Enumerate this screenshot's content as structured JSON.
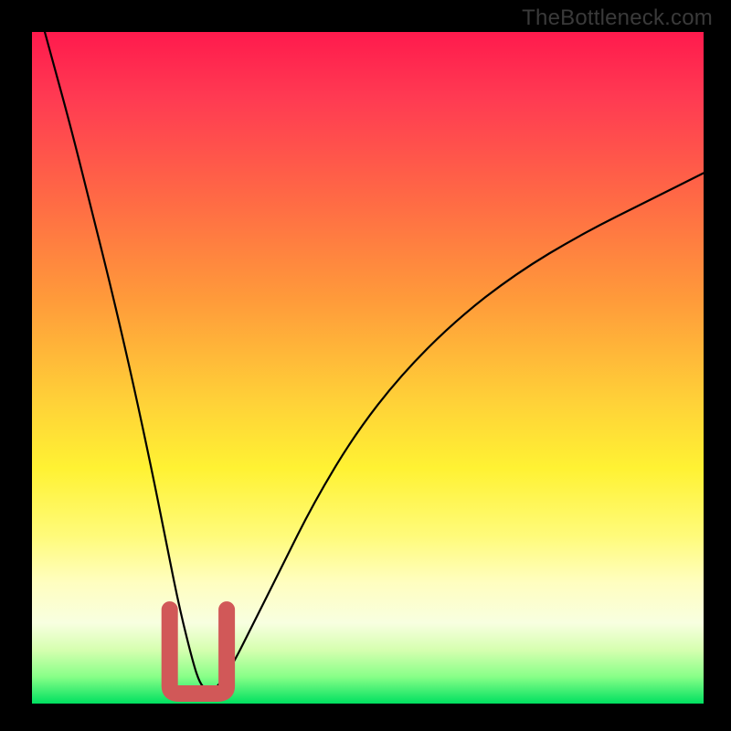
{
  "watermark": "TheBottleneck.com",
  "chart_data": {
    "type": "line",
    "title": "",
    "xlabel": "",
    "ylabel": "",
    "xlim": [
      0,
      100
    ],
    "ylim": [
      0,
      100
    ],
    "grid": false,
    "legend": false,
    "background": "vertical-rainbow-gradient (red→orange→yellow→green)",
    "series": [
      {
        "name": "bottleneck-curve",
        "x": [
          0,
          3,
          6,
          9,
          12,
          15,
          18,
          20,
          22,
          24,
          25,
          26,
          27,
          28,
          30,
          33,
          37,
          42,
          48,
          55,
          63,
          72,
          82,
          92,
          100
        ],
        "values": [
          107,
          96,
          85,
          73,
          61,
          48,
          34,
          24,
          14,
          6,
          3,
          2,
          2,
          3,
          6,
          12,
          20,
          30,
          40,
          49,
          57,
          64,
          70,
          75,
          79
        ]
      }
    ],
    "annotations": [
      {
        "name": "optimal-zone-marker",
        "type": "thick-u-shape",
        "color": "#d15858",
        "x_range": [
          20.5,
          29
        ],
        "y_range": [
          1.5,
          14
        ]
      }
    ]
  }
}
